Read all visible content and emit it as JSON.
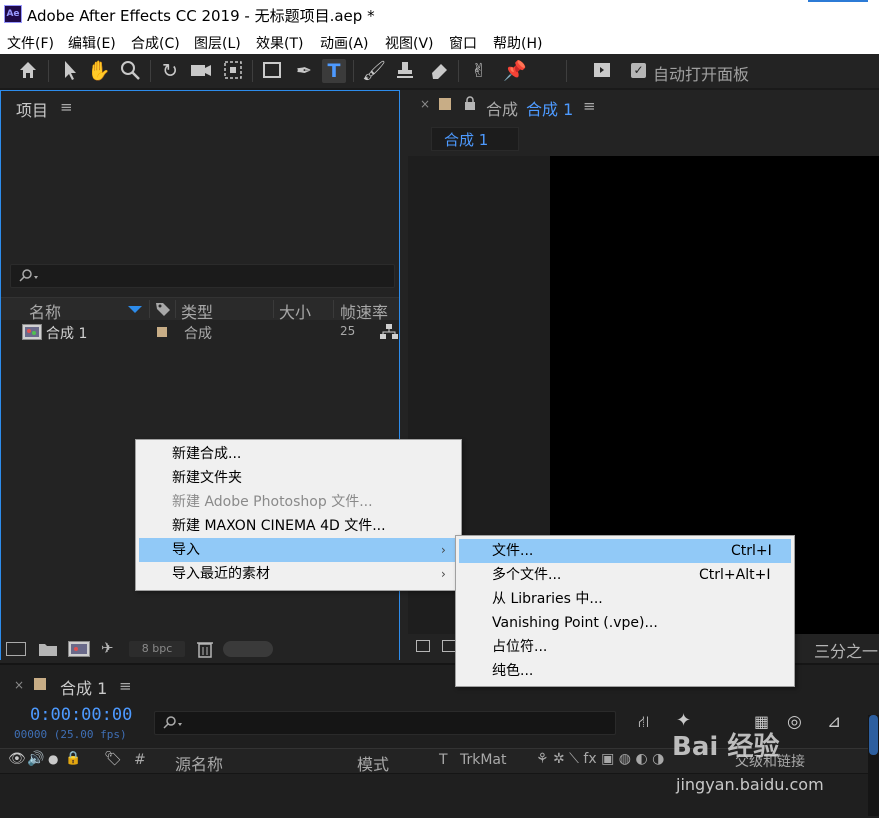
{
  "window": {
    "title": "Adobe After Effects CC 2019 - 无标题项目.aep *",
    "logo": "Ae"
  },
  "menubar": [
    "文件(F)",
    "编辑(E)",
    "合成(C)",
    "图层(L)",
    "效果(T)",
    "动画(A)",
    "视图(V)",
    "窗口",
    "帮助(H)"
  ],
  "toolbar": {
    "auto_open_label": "自动打开面板",
    "auto_open_checked": true
  },
  "project": {
    "title": "项目",
    "columns": {
      "name": "名称",
      "type": "类型",
      "size": "大小",
      "fps": "帧速率"
    },
    "items": [
      {
        "name": "合成 1",
        "type": "合成",
        "fps": "25"
      }
    ],
    "bpc": "8 bpc"
  },
  "comp": {
    "tab_title_prefix": "合成",
    "tab_title_name": "合成 1",
    "subtab": "合成 1",
    "view_dropdown": "三分之一"
  },
  "timeline": {
    "tab": "合成 1",
    "time": "0:00:00:00",
    "frames": "00000 (25.00 fps)",
    "columns": {
      "hash": "#",
      "source": "源名称",
      "mode": "模式",
      "t": "T",
      "trkmat": "TrkMat",
      "parent": "父级和链接"
    }
  },
  "context_menu": {
    "items": [
      {
        "label": "新建合成...",
        "enabled": true
      },
      {
        "label": "新建文件夹",
        "enabled": true
      },
      {
        "label": "新建 Adobe Photoshop 文件...",
        "enabled": false
      },
      {
        "label": "新建 MAXON CINEMA 4D 文件...",
        "enabled": true
      },
      {
        "label": "导入",
        "enabled": true,
        "submenu": true,
        "highlighted": true
      },
      {
        "label": "导入最近的素材",
        "enabled": true,
        "submenu": true
      }
    ]
  },
  "import_submenu": {
    "items": [
      {
        "label": "文件...",
        "shortcut": "Ctrl+I",
        "highlighted": true
      },
      {
        "label": "多个文件...",
        "shortcut": "Ctrl+Alt+I"
      },
      {
        "label": "从 Libraries 中..."
      },
      {
        "label": "Vanishing Point (.vpe)..."
      },
      {
        "label": "占位符..."
      },
      {
        "label": "纯色..."
      }
    ]
  },
  "watermark": {
    "text": "Bai 经验",
    "url": "jingyan.baidu.com"
  },
  "colors": {
    "accent_blue": "#2d8ceb",
    "timecode_blue": "#4d9aff",
    "menu_highlight": "#91c9f7",
    "label_tan": "#c8ad86"
  }
}
